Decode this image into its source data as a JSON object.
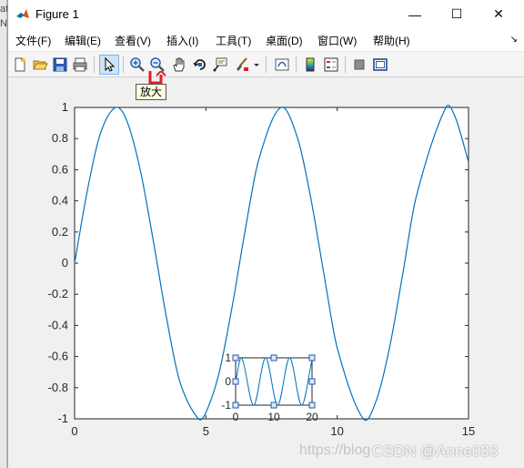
{
  "left_strip": {
    "line1": "at",
    "line2": "N"
  },
  "window": {
    "title": "Figure 1",
    "controls": {
      "minimize": "—",
      "maximize": "☐",
      "close": "✕"
    }
  },
  "menu": {
    "items": [
      "文件(F)",
      "编辑(E)",
      "查看(V)",
      "插入(I)",
      "工具(T)",
      "桌面(D)",
      "窗口(W)",
      "帮助(H)"
    ],
    "dock_icon": "dock-arrow-icon",
    "dock_glyph": "↘"
  },
  "toolbar": {
    "buttons": [
      "new-figure-icon",
      "open-file-icon",
      "save-icon",
      "print-icon",
      "edit-plot-arrow-icon",
      "zoom-in-icon",
      "zoom-out-icon",
      "pan-hand-icon",
      "rotate-3d-icon",
      "data-cursor-icon",
      "brush-icon",
      "link-plot-icon",
      "colorbar-icon",
      "legend-icon",
      "hide-plot-tools-icon",
      "show-plot-tools-icon"
    ],
    "tooltip": "放大"
  },
  "colors": {
    "line": "#0072bd",
    "axes_bg": "#ffffff",
    "figure_bg": "#f0f0f0",
    "annotation": "#e02020"
  },
  "chart_data": [
    {
      "type": "line",
      "function": "sin(x)",
      "x": [
        0,
        0.5,
        1,
        1.5708,
        2,
        2.5,
        3,
        3.5,
        4,
        4.7124,
        5,
        5.5,
        6,
        6.5,
        7,
        7.854,
        8.5,
        9,
        9.5,
        10,
        10.9956,
        11.5,
        12,
        12.5,
        13,
        14.1372,
        14.5,
        15
      ],
      "y": [
        0,
        0.479,
        0.841,
        1,
        0.909,
        0.598,
        0.141,
        -0.351,
        -0.757,
        -1,
        -0.959,
        -0.706,
        -0.279,
        0.215,
        0.657,
        1,
        0.798,
        0.412,
        -0.075,
        -0.544,
        -1,
        -0.876,
        -0.537,
        -0.066,
        0.42,
        1,
        0.935,
        0.65
      ],
      "xlim": [
        0,
        15
      ],
      "ylim": [
        -1,
        1
      ],
      "xticks": [
        "0",
        "5",
        "10",
        "15"
      ],
      "yticks": [
        "-1",
        "-0.8",
        "-0.6",
        "-0.4",
        "-0.2",
        "0",
        "0.2",
        "0.4",
        "0.6",
        "0.8",
        "1"
      ],
      "grid": false
    },
    {
      "type": "line",
      "function": "sin(x)",
      "x": [
        0,
        1.5708,
        4.7124,
        7.854,
        10.9956,
        14.1372,
        17.2788,
        20
      ],
      "y": [
        0,
        1,
        -1,
        1,
        -1,
        1,
        -1,
        0.913
      ],
      "xlim": [
        0,
        20
      ],
      "ylim": [
        -1,
        1
      ],
      "xticks": [
        "0",
        "10",
        "20"
      ],
      "yticks": [
        "-1",
        "0",
        "1"
      ],
      "selected": true
    }
  ],
  "watermark": {
    "text1": "https://blog",
    "text2": "CSDN @Anne033"
  }
}
